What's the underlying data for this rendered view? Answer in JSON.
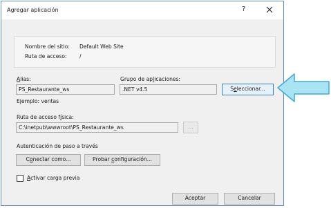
{
  "window": {
    "title": "Agregar aplicación",
    "help_glyph": "?",
    "close_glyph": "✕"
  },
  "site": {
    "site_label": "Nombre del sitio:",
    "site_value": "Default Web Site",
    "path_label": "Ruta de acceso:",
    "path_value": "/"
  },
  "alias": {
    "label_key": "A",
    "label_rest": "lias:",
    "value": "PS_Restaurante_ws",
    "example": "Ejemplo: ventas"
  },
  "pool": {
    "label_pre": "Grupo de ap",
    "label_key": "l",
    "label_post": "icaciones:",
    "value": ".NET v4.5",
    "select_pre": "S",
    "select_key": "e",
    "select_post": "leccionar..."
  },
  "physical_path": {
    "label_pre": "Ruta de acceso f",
    "label_key": "í",
    "label_post": "sica:",
    "value": "C:\\inetpub\\wwwroot\\PS_Restaurante_ws",
    "browse_label": "..."
  },
  "auth": {
    "title": "Autenticación de paso a través",
    "connect_pre": "C",
    "connect_key": "o",
    "connect_post": "nectar como...",
    "test_pre": "Probar ",
    "test_key": "c",
    "test_post": "onfiguración..."
  },
  "preload": {
    "checked": false,
    "label_key": "A",
    "label_rest": "ctivar carga previa"
  },
  "buttons": {
    "ok": "Aceptar",
    "cancel": "Cancelar"
  },
  "colors": {
    "arrow_fill": "#a9e4f3",
    "arrow_stroke": "#3fa9d6",
    "dialog_border": "#5f8bbf"
  }
}
